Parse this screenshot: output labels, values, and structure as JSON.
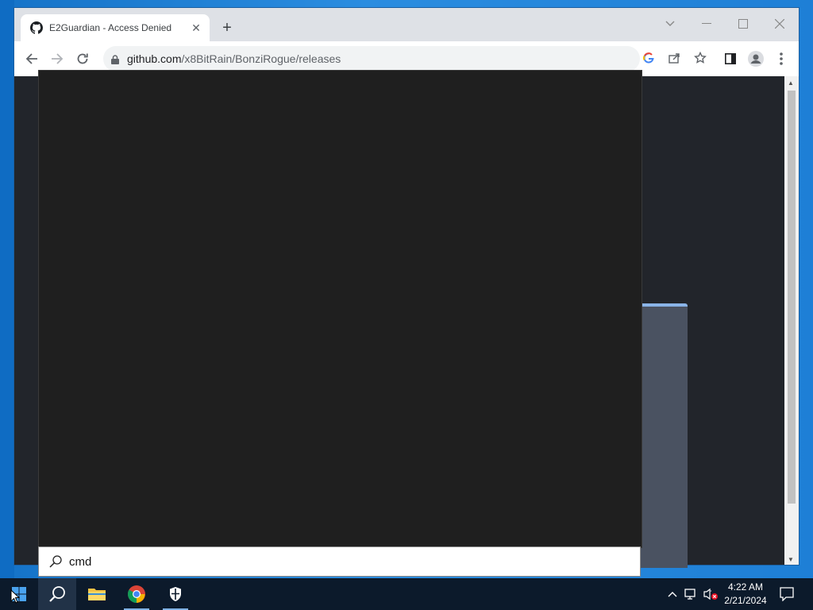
{
  "browser": {
    "tab": {
      "title": "E2Guardian - Access Denied",
      "favicon": "github-icon"
    },
    "url": {
      "host": "github.com",
      "path": "/x8BitRain/BonziRogue/releases"
    }
  },
  "search": {
    "query": "cmd"
  },
  "taskbar": {
    "apps": [
      "start-icon",
      "search-icon",
      "file-explorer-icon",
      "chrome-icon",
      "windows-security-icon"
    ],
    "clock": {
      "time": "4:22 AM",
      "date": "2/21/2024"
    }
  },
  "colors": {
    "flyout_background": "#1f1f1f",
    "page_background": "#22252b",
    "taskbar": "#0c1a2b",
    "desktop": "#1e7fd6"
  }
}
